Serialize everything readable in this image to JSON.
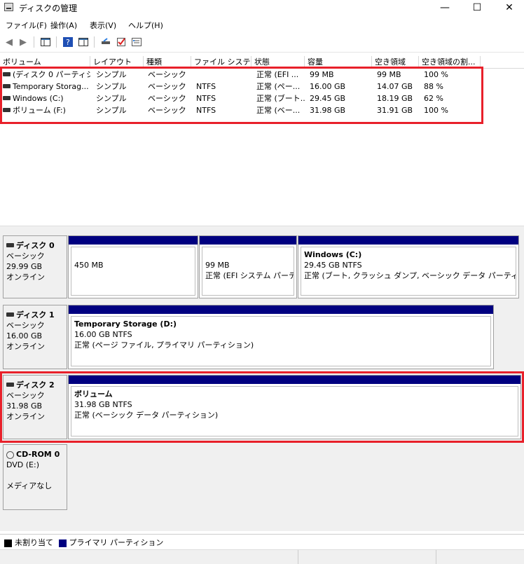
{
  "window": {
    "title": "ディスクの管理",
    "minimize": "—",
    "maximize": "☐",
    "close": "✕"
  },
  "menu": [
    "ファイル(F)",
    "操作(A)",
    "表示(V)",
    "ヘルプ(H)"
  ],
  "toolbar": [
    "back-icon",
    "forward-icon",
    "panel-icon",
    "help-icon",
    "view-icon",
    "connect-icon",
    "check-icon",
    "properties-icon"
  ],
  "list": {
    "headers": [
      "ボリューム",
      "レイアウト",
      "種類",
      "ファイル システム",
      "状態",
      "容量",
      "空き領域",
      "空き領域の割..."
    ],
    "rows": [
      [
        "(ディスク 0 パーティシ...",
        "シンプル",
        "ベーシック",
        "",
        "正常 (EFI ...",
        "99 MB",
        "99 MB",
        "100 %"
      ],
      [
        "Temporary Storag...",
        "シンプル",
        "ベーシック",
        "NTFS",
        "正常 (ペー...",
        "16.00 GB",
        "14.07 GB",
        "88 %"
      ],
      [
        "Windows (C:)",
        "シンプル",
        "ベーシック",
        "NTFS",
        "正常 (ブート...",
        "29.45 GB",
        "18.19 GB",
        "62 %"
      ],
      [
        "ボリューム (F:)",
        "シンプル",
        "ベーシック",
        "NTFS",
        "正常 (ベー...",
        "31.98 GB",
        "31.91 GB",
        "100 %"
      ]
    ]
  },
  "disks": [
    {
      "name": "ディスク 0",
      "type": "ベーシック",
      "size": "29.99 GB",
      "status": "オンライン",
      "partitions": [
        {
          "title": "",
          "line1": "450 MB",
          "line2": ""
        },
        {
          "title": "",
          "line1": "99 MB",
          "line2": "正常 (EFI システム パーティ"
        },
        {
          "title": "Windows  (C:)",
          "line1": "29.45 GB NTFS",
          "line2": "正常 (ブート, クラッシュ ダンプ, ベーシック データ パーティション)"
        }
      ]
    },
    {
      "name": "ディスク 1",
      "type": "ベーシック",
      "size": "16.00 GB",
      "status": "オンライン",
      "partitions": [
        {
          "title": "Temporary Storage  (D:)",
          "line1": "16.00 GB NTFS",
          "line2": "正常 (ページ ファイル, プライマリ パーティション)"
        }
      ]
    },
    {
      "name": "ディスク 2",
      "type": "ベーシック",
      "size": "31.98 GB",
      "status": "オンライン",
      "partitions": [
        {
          "title": "ボリューム",
          "line1": "31.98 GB NTFS",
          "line2": "正常 (ベーシック データ パーティション)"
        }
      ]
    },
    {
      "name": "CD-ROM 0",
      "type": "DVD (E:)",
      "size": "",
      "status": "メディアなし"
    }
  ],
  "legend": {
    "unallocated": "未割り当て",
    "primary": "プライマリ パーティション"
  },
  "colors": {
    "partition_bar": "#000080",
    "unallocated": "#000000",
    "highlight": "#e8202a"
  }
}
